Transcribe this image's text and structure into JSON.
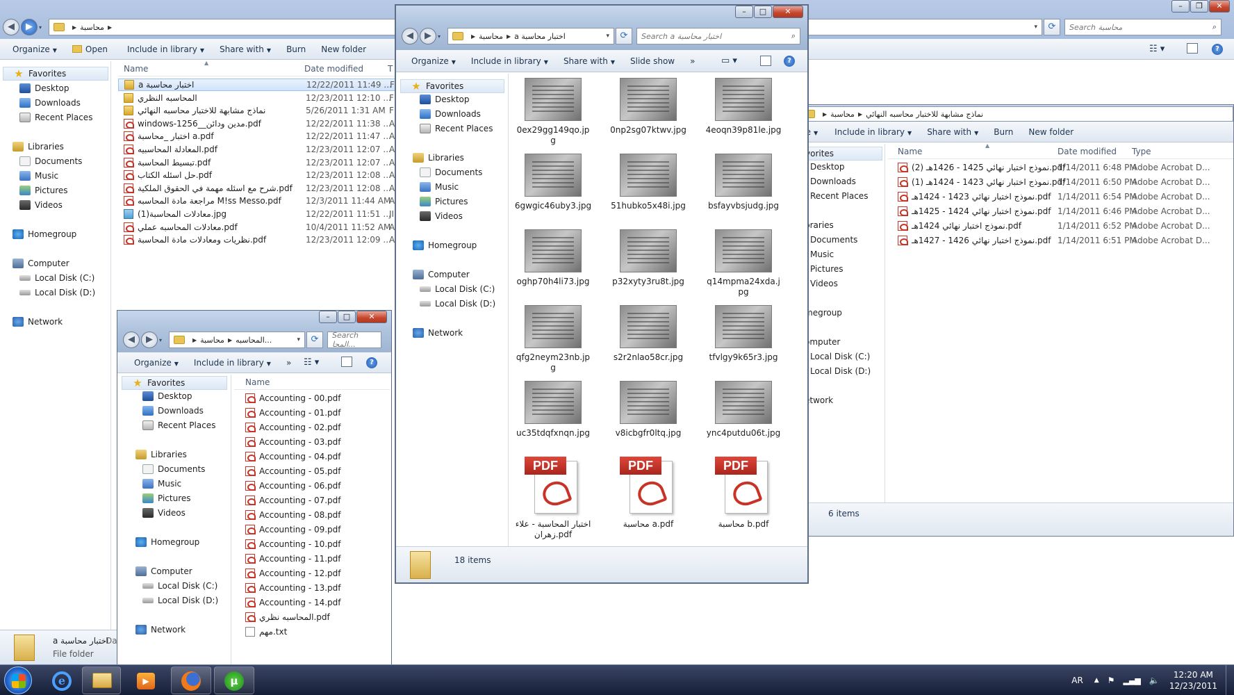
{
  "win_main": {
    "path": [
      "محاسبة"
    ],
    "search_placeholder": "Search محاسبة",
    "toolbar": [
      "Organize",
      "Open",
      "Include in library",
      "Share with",
      "Burn",
      "New folder"
    ],
    "columns": [
      "Name",
      "Date modified",
      "T"
    ],
    "nav": {
      "favorites": "Favorites",
      "desktop": "Desktop",
      "downloads": "Downloads",
      "recent": "Recent Places",
      "libraries": "Libraries",
      "documents": "Documents",
      "music": "Music",
      "pictures": "Pictures",
      "videos": "Videos",
      "homegroup": "Homegroup",
      "computer": "Computer",
      "disk_c": "Local Disk (C:)",
      "disk_d": "Local Disk (D:)",
      "network": "Network"
    },
    "files": [
      {
        "name": "a اختبار محاسبة",
        "date": "12/22/2011 11:49 ...",
        "type": "F",
        "icon": "folder",
        "selected": true
      },
      {
        "name": "المحاسبه النظري",
        "date": "12/23/2011 12:10 ...",
        "type": "F",
        "icon": "folder"
      },
      {
        "name": "نماذج مشابهة للاختبار محاسبه النهائي",
        "date": "5/26/2011 1:31 AM",
        "type": "F",
        "icon": "folder"
      },
      {
        "name": "windows-1256__مدين ودائن.pdf",
        "date": "12/22/2011 11:38 ...",
        "type": "A",
        "icon": "pdf"
      },
      {
        "name": "اختبار _محاسبة a.pdf",
        "date": "12/22/2011 11:47 ...",
        "type": "A",
        "icon": "pdf"
      },
      {
        "name": "المعادلة المحاسبيه.pdf",
        "date": "12/23/2011 12:07 ...",
        "type": "A",
        "icon": "pdf"
      },
      {
        "name": "تبسيط المحاسبة.pdf",
        "date": "12/23/2011 12:07 ...",
        "type": "A",
        "icon": "pdf"
      },
      {
        "name": "حل اسئله الكتاب.pdf",
        "date": "12/23/2011 12:08 ...",
        "type": "A",
        "icon": "pdf"
      },
      {
        "name": "شرح مع اسئله مهمة في الحقوق الملكية.pdf",
        "date": "12/23/2011 12:08 ...",
        "type": "A",
        "icon": "pdf"
      },
      {
        "name": "مراجعة مادة المحاسبه M!ss Messo.pdf",
        "date": "12/3/2011 11:44 AM",
        "type": "A",
        "icon": "pdf"
      },
      {
        "name": "(معادلات المحاسبة(1.jpg",
        "date": "12/22/2011 11:51 ...",
        "type": "JI",
        "icon": "jpg"
      },
      {
        "name": "معادلات المحاسبه عملي.pdf",
        "date": "10/4/2011 11:52 AM",
        "type": "A",
        "icon": "pdf"
      },
      {
        "name": "نظريات ومعادلات مادة المحاسبة.pdf",
        "date": "12/23/2011 12:09 ...",
        "type": "A",
        "icon": "pdf"
      }
    ],
    "details": {
      "name": "a اختبار محاسبة",
      "kind": "File folder",
      "extra": "Da"
    }
  },
  "win_right": {
    "path": [
      "محاسبة",
      "نماذج مشابهة للاختبار محاسبه النهائي"
    ],
    "search_placeholder": "Search محاسبة",
    "toolbar": [
      "ize",
      "Include in library",
      "Share with",
      "Burn",
      "New folder"
    ],
    "columns": [
      "Name",
      "Date modified",
      "Type"
    ],
    "nav": [
      "vorites",
      "Desktop",
      "Downloads",
      "Recent Places",
      "braries",
      "Documents",
      "Music",
      "Pictures",
      "Videos",
      "megroup",
      "omputer",
      "Local Disk (C:)",
      "Local Disk (D:)",
      "etwork"
    ],
    "files": [
      {
        "name": "نموذج اختبار نهائي 1425 - 1426هـ (2).pdf",
        "date": "1/14/2011 6:48 PM",
        "type": "Adobe Acrobat D..."
      },
      {
        "name": "نموذج اختبار نهائي 1423 - 1424هـ (1).pdf",
        "date": "1/14/2011 6:50 PM",
        "type": "Adobe Acrobat D..."
      },
      {
        "name": "نموذج اختبار نهائي 1423 - 1424هـ.pdf",
        "date": "1/14/2011 6:54 PM",
        "type": "Adobe Acrobat D..."
      },
      {
        "name": "نموذج اختبار نهائي 1424 - 1425هـ.pdf",
        "date": "1/14/2011 6:46 PM",
        "type": "Adobe Acrobat D..."
      },
      {
        "name": "نموذج اختبار نهائي 1424هـ.pdf",
        "date": "1/14/2011 6:52 PM",
        "type": "Adobe Acrobat D..."
      },
      {
        "name": "نموذج اختبار نهائي 1426 - 1427هـ.pdf",
        "date": "1/14/2011 6:51 PM",
        "type": "Adobe Acrobat D..."
      }
    ],
    "status": "6 items"
  },
  "win_center": {
    "path": [
      "محاسبة",
      "a اختبار محاسبة"
    ],
    "search_placeholder": "Search a اختبار محاسبة",
    "toolbar": [
      "Organize",
      "Include in library",
      "Share with",
      "Slide show",
      "»"
    ],
    "nav": {
      "favorites": "Favorites",
      "desktop": "Desktop",
      "downloads": "Downloads",
      "recent": "Recent Places",
      "libraries": "Libraries",
      "documents": "Documents",
      "music": "Music",
      "pictures": "Pictures",
      "videos": "Videos",
      "homegroup": "Homegroup",
      "computer": "Computer",
      "disk_c": "Local Disk (C:)",
      "disk_d": "Local Disk (D:)",
      "network": "Network"
    },
    "thumbs": [
      {
        "label": "0ex29gg149qo.jpg",
        "kind": "jpg"
      },
      {
        "label": "0np2sg07ktwv.jpg",
        "kind": "jpg"
      },
      {
        "label": "4eoqn39p81le.jpg",
        "kind": "jpg"
      },
      {
        "label": "6gwgic46uby3.jpg",
        "kind": "jpg"
      },
      {
        "label": "51hubko5x48i.jpg",
        "kind": "jpg"
      },
      {
        "label": "bsfayvbsjudg.jpg",
        "kind": "jpg"
      },
      {
        "label": "oghp70h4li73.jpg",
        "kind": "jpg"
      },
      {
        "label": "p32xyty3ru8t.jpg",
        "kind": "jpg"
      },
      {
        "label": "q14mpma24xda.jpg",
        "kind": "jpg"
      },
      {
        "label": "qfg2neym23nb.jpg",
        "kind": "jpg"
      },
      {
        "label": "s2r2nlao58cr.jpg",
        "kind": "jpg"
      },
      {
        "label": "tfvlgy9k65r3.jpg",
        "kind": "jpg"
      },
      {
        "label": "uc35tdqfxnqn.jpg",
        "kind": "jpg"
      },
      {
        "label": "v8icbgfr0ltq.jpg",
        "kind": "jpg"
      },
      {
        "label": "ync4putdu06t.jpg",
        "kind": "jpg"
      },
      {
        "label": "اختبار المحاسبة - علاء زهران.pdf",
        "kind": "pdf"
      },
      {
        "label": "محاسبة a.pdf",
        "kind": "pdf"
      },
      {
        "label": "محاسبة b.pdf",
        "kind": "pdf"
      }
    ],
    "pdf_tag": "PDF",
    "status": "18 items"
  },
  "win_small": {
    "path": [
      "محاسبة",
      "المحاسبه..."
    ],
    "search_placeholder": "Search المحا...",
    "toolbar": [
      "Organize",
      "Include in library",
      "»"
    ],
    "column": "Name",
    "nav": {
      "favorites": "Favorites",
      "desktop": "Desktop",
      "downloads": "Downloads",
      "recent": "Recent Places",
      "libraries": "Libraries",
      "documents": "Documents",
      "music": "Music",
      "pictures": "Pictures",
      "videos": "Videos",
      "homegroup": "Homegroup",
      "computer": "Computer",
      "disk_c": "Local Disk (C:)",
      "disk_d": "Local Disk (D:)",
      "network": "Network"
    },
    "files": [
      {
        "name": "Accounting - 00.pdf",
        "icon": "pdf"
      },
      {
        "name": "Accounting - 01.pdf",
        "icon": "pdf"
      },
      {
        "name": "Accounting - 02.pdf",
        "icon": "pdf"
      },
      {
        "name": "Accounting - 03.pdf",
        "icon": "pdf"
      },
      {
        "name": "Accounting - 04.pdf",
        "icon": "pdf"
      },
      {
        "name": "Accounting - 05.pdf",
        "icon": "pdf"
      },
      {
        "name": "Accounting - 06.pdf",
        "icon": "pdf"
      },
      {
        "name": "Accounting - 07.pdf",
        "icon": "pdf"
      },
      {
        "name": "Accounting - 08.pdf",
        "icon": "pdf"
      },
      {
        "name": "Accounting - 09.pdf",
        "icon": "pdf"
      },
      {
        "name": "Accounting - 10.pdf",
        "icon": "pdf"
      },
      {
        "name": "Accounting - 11.pdf",
        "icon": "pdf"
      },
      {
        "name": "Accounting - 12.pdf",
        "icon": "pdf"
      },
      {
        "name": "Accounting - 13.pdf",
        "icon": "pdf"
      },
      {
        "name": "Accounting - 14.pdf",
        "icon": "pdf"
      },
      {
        "name": "المحاسبه نظري.pdf",
        "icon": "pdf"
      },
      {
        "name": "مهم.txt",
        "icon": "txt"
      }
    ]
  },
  "taskbar": {
    "lang": "AR",
    "time": "12:20 AM",
    "date": "12/23/2011",
    "apps": [
      "internet-explorer-icon",
      "explorer-icon",
      "media-player-icon",
      "firefox-icon",
      "utorrent-icon"
    ]
  }
}
